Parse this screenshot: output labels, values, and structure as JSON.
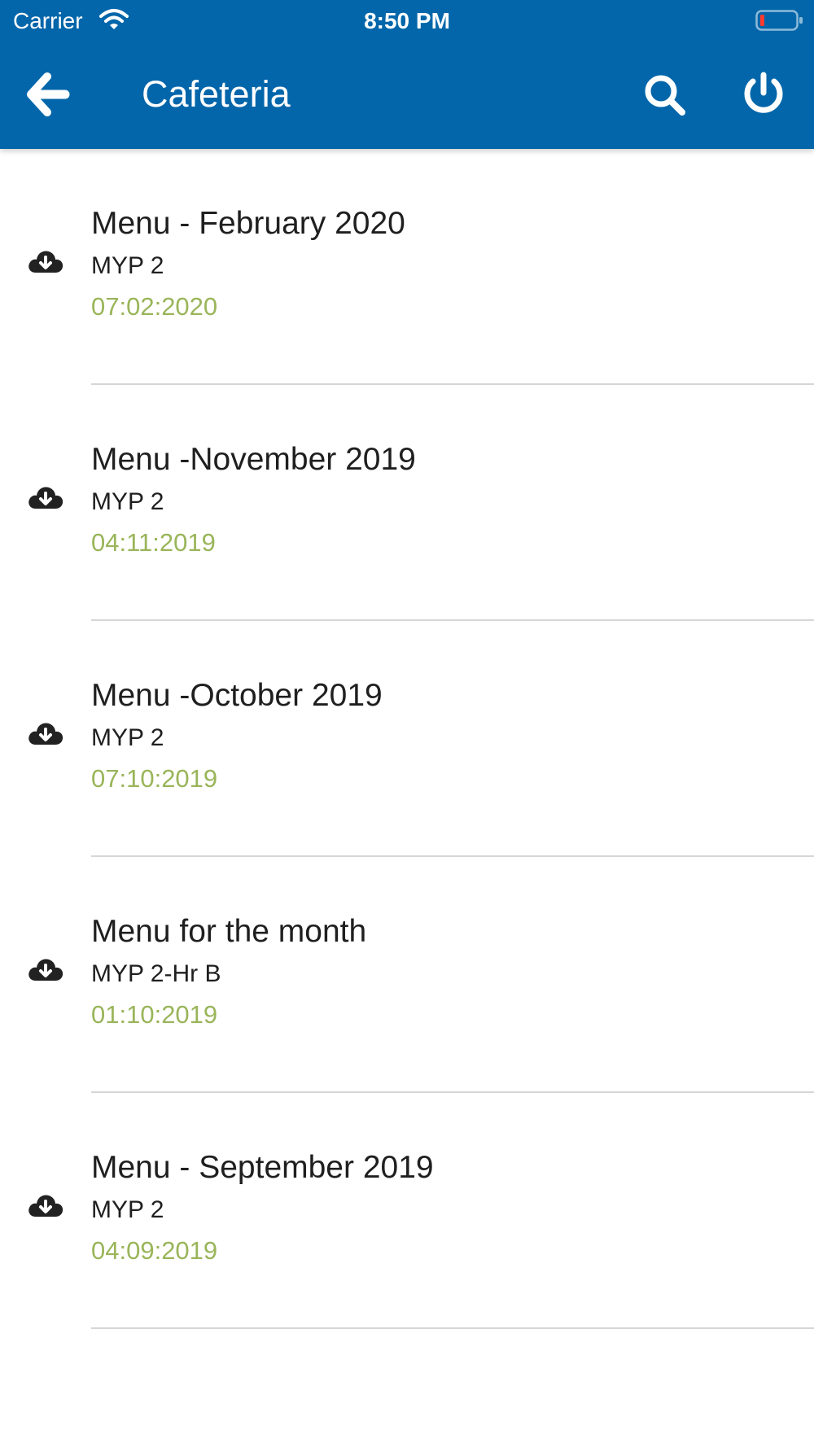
{
  "status_bar": {
    "carrier": "Carrier",
    "time": "8:50 PM"
  },
  "header": {
    "title": "Cafeteria",
    "back_icon": "arrow-left-icon",
    "search_icon": "search-icon",
    "power_icon": "power-icon"
  },
  "colors": {
    "header_background": "#0366aa",
    "date_text": "#9ab55a",
    "battery_low": "#ff3b30"
  },
  "items": [
    {
      "title": "Menu - February 2020",
      "subtitle": "MYP 2",
      "date": "07:02:2020",
      "icon": "cloud-download-icon"
    },
    {
      "title": "Menu -November 2019",
      "subtitle": "MYP 2",
      "date": "04:11:2019",
      "icon": "cloud-download-icon"
    },
    {
      "title": "Menu -October 2019",
      "subtitle": "MYP 2",
      "date": "07:10:2019",
      "icon": "cloud-download-icon"
    },
    {
      "title": "Menu for the month",
      "subtitle": "MYP 2-Hr B",
      "date": "01:10:2019",
      "icon": "cloud-download-icon"
    },
    {
      "title": "Menu - September 2019",
      "subtitle": "MYP 2",
      "date": "04:09:2019",
      "icon": "cloud-download-icon"
    }
  ]
}
